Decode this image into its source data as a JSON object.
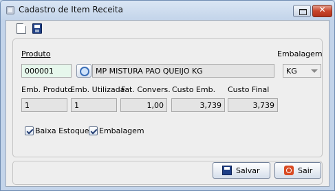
{
  "window": {
    "title": "Cadastro de Item Receita"
  },
  "toolbar": {
    "new_icon": "new-document-icon",
    "save_icon": "floppy-disk-icon"
  },
  "form": {
    "produto_label": "Produto",
    "produto_code": "000001",
    "produto_name": "MP MISTURA PAO QUEIJO KG",
    "embalagem_label": "Embalagem",
    "embalagem_value": "KG",
    "emb_produto_label": "Emb. Produto",
    "emb_produto_value": "1",
    "emb_utilizada_label": "Emb. Utilizada",
    "emb_utilizada_value": "1",
    "fat_convers_label": "Fat. Convers.",
    "fat_convers_value": "1,00",
    "custo_emb_label": "Custo Emb.",
    "custo_emb_value": "3,739",
    "custo_final_label": "Custo Final",
    "custo_final_value": "3,739",
    "baixa_estoque_label": "Baixa Estoque",
    "baixa_estoque_checked": true,
    "embalagem_chk_label": "Embalagem",
    "embalagem_chk_checked": true
  },
  "buttons": {
    "salvar": "Salvar",
    "sair": "Sair"
  }
}
